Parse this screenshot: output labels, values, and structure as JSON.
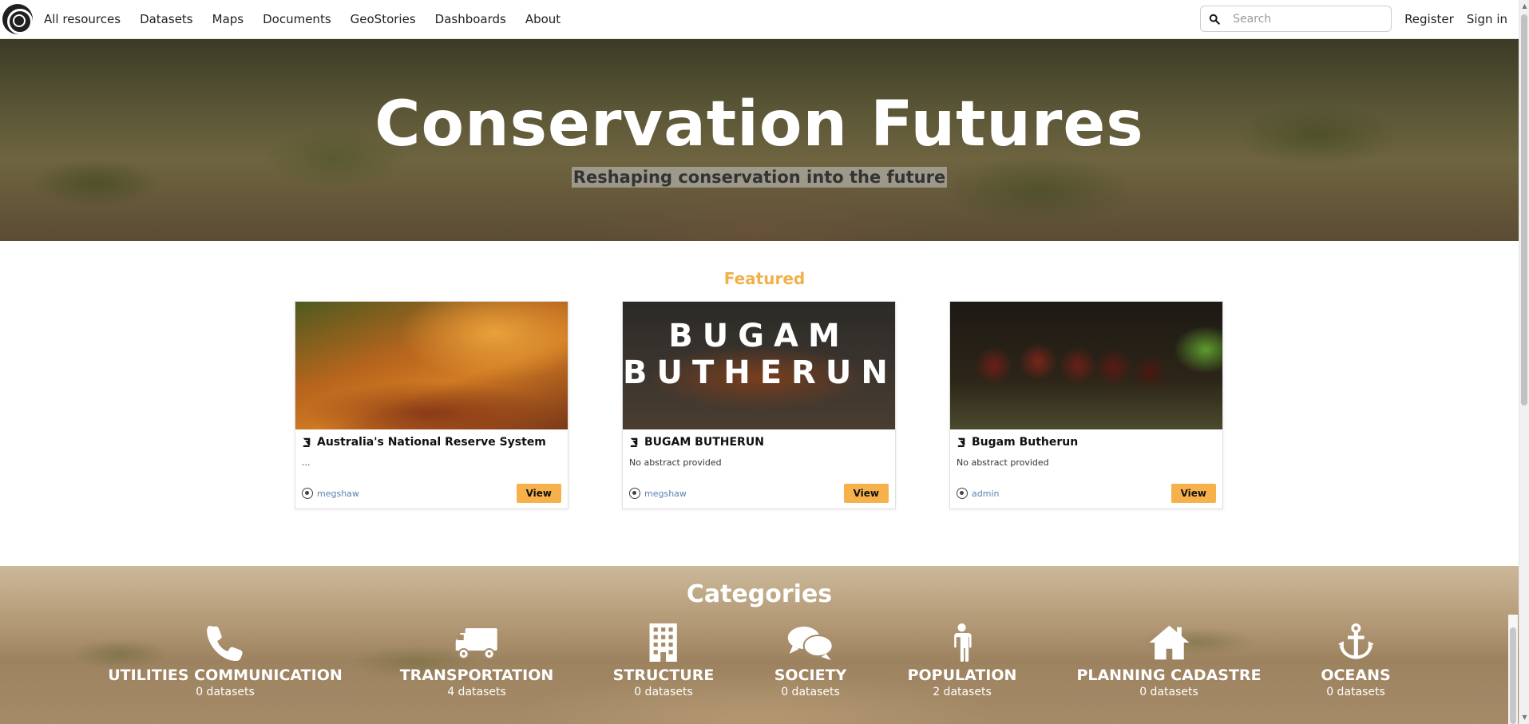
{
  "nav": {
    "links": [
      "All resources",
      "Datasets",
      "Maps",
      "Documents",
      "GeoStories",
      "Dashboards",
      "About"
    ],
    "search_placeholder": "Search",
    "register": "Register",
    "sign_in": "Sign in"
  },
  "hero": {
    "title": "Conservation Futures",
    "subtitle": "Reshaping conservation into the future"
  },
  "featured": {
    "heading": "Featured",
    "cards": [
      {
        "title": "Australia's National Reserve System",
        "abstract": "...",
        "owner": "megshaw",
        "view": "View",
        "image_text": ""
      },
      {
        "title": "BUGAM BUTHERUN",
        "abstract": "No abstract provided",
        "owner": "megshaw",
        "view": "View",
        "image_text": "BUGAM BUTHERUN"
      },
      {
        "title": "Bugam Butherun",
        "abstract": "No abstract provided",
        "owner": "admin",
        "view": "View",
        "image_text": ""
      }
    ]
  },
  "categories": {
    "heading": "Categories",
    "items": [
      {
        "name": "UTILITIES COMMUNICATION",
        "count": "0 datasets",
        "icon": "phone-icon"
      },
      {
        "name": "TRANSPORTATION",
        "count": "4 datasets",
        "icon": "truck-icon"
      },
      {
        "name": "STRUCTURE",
        "count": "0 datasets",
        "icon": "building-icon"
      },
      {
        "name": "SOCIETY",
        "count": "0 datasets",
        "icon": "comments-icon"
      },
      {
        "name": "POPULATION",
        "count": "2 datasets",
        "icon": "person-icon"
      },
      {
        "name": "PLANNING CADASTRE",
        "count": "0 datasets",
        "icon": "home-icon"
      },
      {
        "name": "OCEANS",
        "count": "0 datasets",
        "icon": "anchor-icon"
      }
    ]
  },
  "colors": {
    "accent": "#f6b14a",
    "featured_heading": "#f2b04a",
    "owner_link": "#5a7fb0"
  }
}
